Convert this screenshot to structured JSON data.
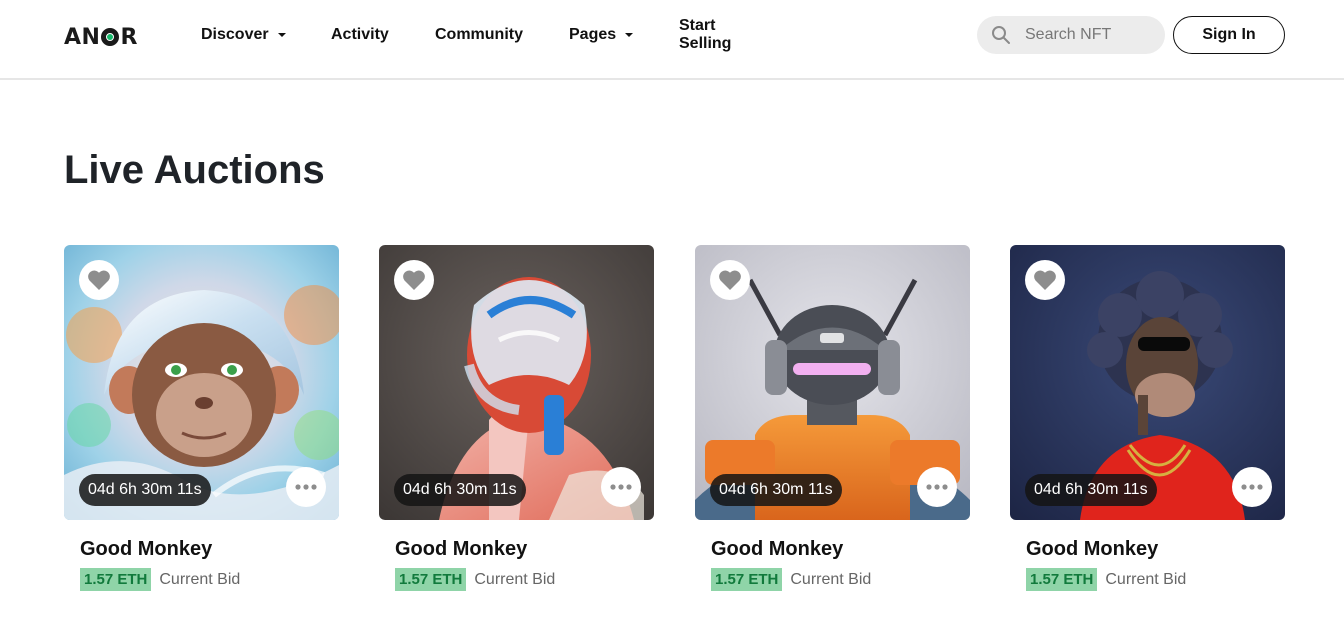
{
  "brand": {
    "logo_text_a": "AN",
    "logo_text_b": "R"
  },
  "nav": {
    "discover": "Discover",
    "activity": "Activity",
    "community": "Community",
    "pages": "Pages",
    "start_selling": "Start Selling"
  },
  "search": {
    "placeholder": "Search NFT",
    "value": ""
  },
  "auth": {
    "sign_in": "Sign In"
  },
  "page": {
    "title": "Live Auctions"
  },
  "colors": {
    "accent_green": "#15b86a",
    "price_bg": "#8fd4a8",
    "price_text": "#117a3c"
  },
  "auctions": [
    {
      "name": "Good Monkey",
      "timer": "04d 6h 30m 11s",
      "price": "1.57 ETH",
      "bid_label": "Current Bid",
      "art": "holographic-monkey"
    },
    {
      "name": "Good Monkey",
      "timer": "04d 6h 30m 11s",
      "price": "1.57 ETH",
      "bid_label": "Current Bid",
      "art": "glass-helmet-figure"
    },
    {
      "name": "Good Monkey",
      "timer": "04d 6h 30m 11s",
      "price": "1.57 ETH",
      "bid_label": "Current Bid",
      "art": "orange-robot"
    },
    {
      "name": "Good Monkey",
      "timer": "04d 6h 30m 11s",
      "price": "1.57 ETH",
      "bid_label": "Current Bid",
      "art": "ape-red-shirt"
    }
  ]
}
